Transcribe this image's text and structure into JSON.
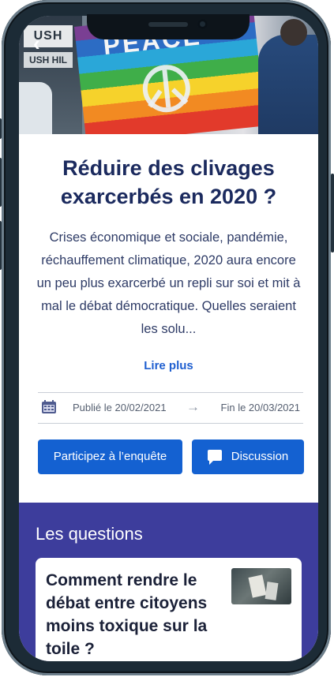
{
  "hero": {
    "flag_text": "PEACE",
    "sign_text": "USH HIL",
    "sign_text_2": "USH HIL",
    "back_icon": "chevron-left-icon"
  },
  "survey": {
    "title": "Réduire des clivages exarcerbés en 2020 ?",
    "description": "Crises économique et sociale, pandémie, réchauffement climatique, 2020 aura encore un peu plus exarcerbé un repli sur soi et mit à mal le débat démocratique. Quelles seraient les solu...",
    "read_more": "Lire plus",
    "published": "Publié le 20/02/2021",
    "arrow": "→",
    "end": "Fin le 20/03/2021",
    "participate_button": "Participez à l’enquête",
    "discussion_button": "Discussion"
  },
  "questions": {
    "heading": "Les questions",
    "items": [
      {
        "text": "Comment rendre le débat entre citoyens moins toxique sur la toile ?"
      }
    ]
  },
  "colors": {
    "title": "#1b2a5e",
    "link": "#1f5fd0",
    "button": "#1461d1",
    "questions_bg": "#3d3d9c"
  }
}
